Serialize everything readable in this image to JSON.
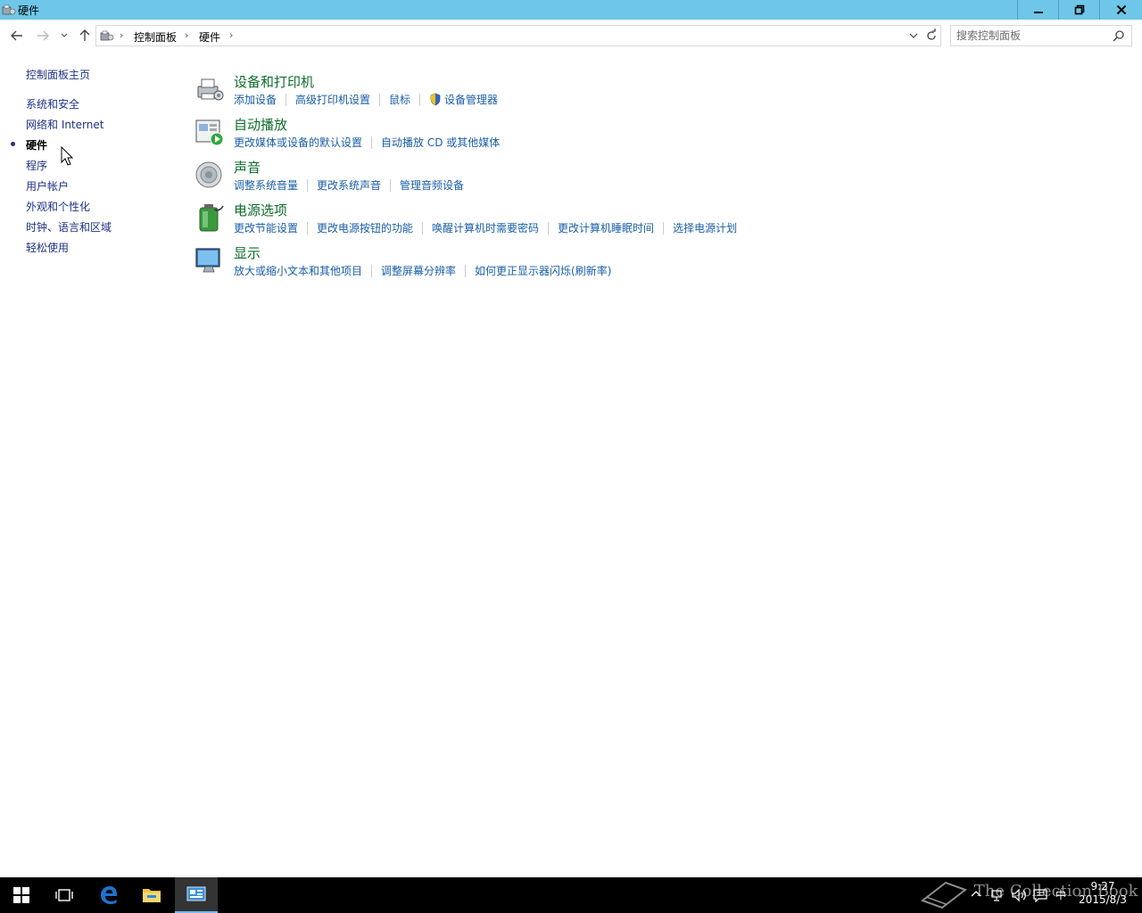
{
  "window": {
    "title": "硬件"
  },
  "breadcrumb": [
    "控制面板",
    "硬件"
  ],
  "search": {
    "placeholder": "搜索控制面板"
  },
  "left_nav": [
    {
      "label": "控制面板主页",
      "current": false
    },
    {
      "label": "系统和安全",
      "current": false
    },
    {
      "label": "网络和 Internet",
      "current": false
    },
    {
      "label": "硬件",
      "current": true
    },
    {
      "label": "程序",
      "current": false
    },
    {
      "label": "用户帐户",
      "current": false
    },
    {
      "label": "外观和个性化",
      "current": false
    },
    {
      "label": "时钟、语言和区域",
      "current": false
    },
    {
      "label": "轻松使用",
      "current": false
    }
  ],
  "categories": [
    {
      "title": "设备和打印机",
      "icon": "printer-icon",
      "links": [
        "添加设备",
        "高级打印机设置",
        "鼠标",
        "设备管理器"
      ]
    },
    {
      "title": "自动播放",
      "icon": "autoplay-icon",
      "links": [
        "更改媒体或设备的默认设置",
        "自动播放 CD 或其他媒体"
      ]
    },
    {
      "title": "声音",
      "icon": "speaker-icon",
      "links": [
        "调整系统音量",
        "更改系统声音",
        "管理音频设备"
      ]
    },
    {
      "title": "电源选项",
      "icon": "battery-icon",
      "links": [
        "更改节能设置",
        "更改电源按钮的功能",
        "唤醒计算机时需要密码",
        "更改计算机睡眠时间",
        "选择电源计划"
      ]
    },
    {
      "title": "显示",
      "icon": "monitor-icon",
      "links": [
        "放大或缩小文本和其他项目",
        "调整屏幕分辨率",
        "如何更正显示器闪烁(刷新率)"
      ]
    }
  ],
  "taskbar": {
    "ime": "中",
    "time": "9:27",
    "date": "2015/8/3"
  },
  "watermark": "The Collection Book",
  "colors": {
    "titlebar": "#6ec6e8",
    "link": "#1a5ea8",
    "category_title": "#0d6c2b",
    "nav_link": "#1e3287"
  }
}
